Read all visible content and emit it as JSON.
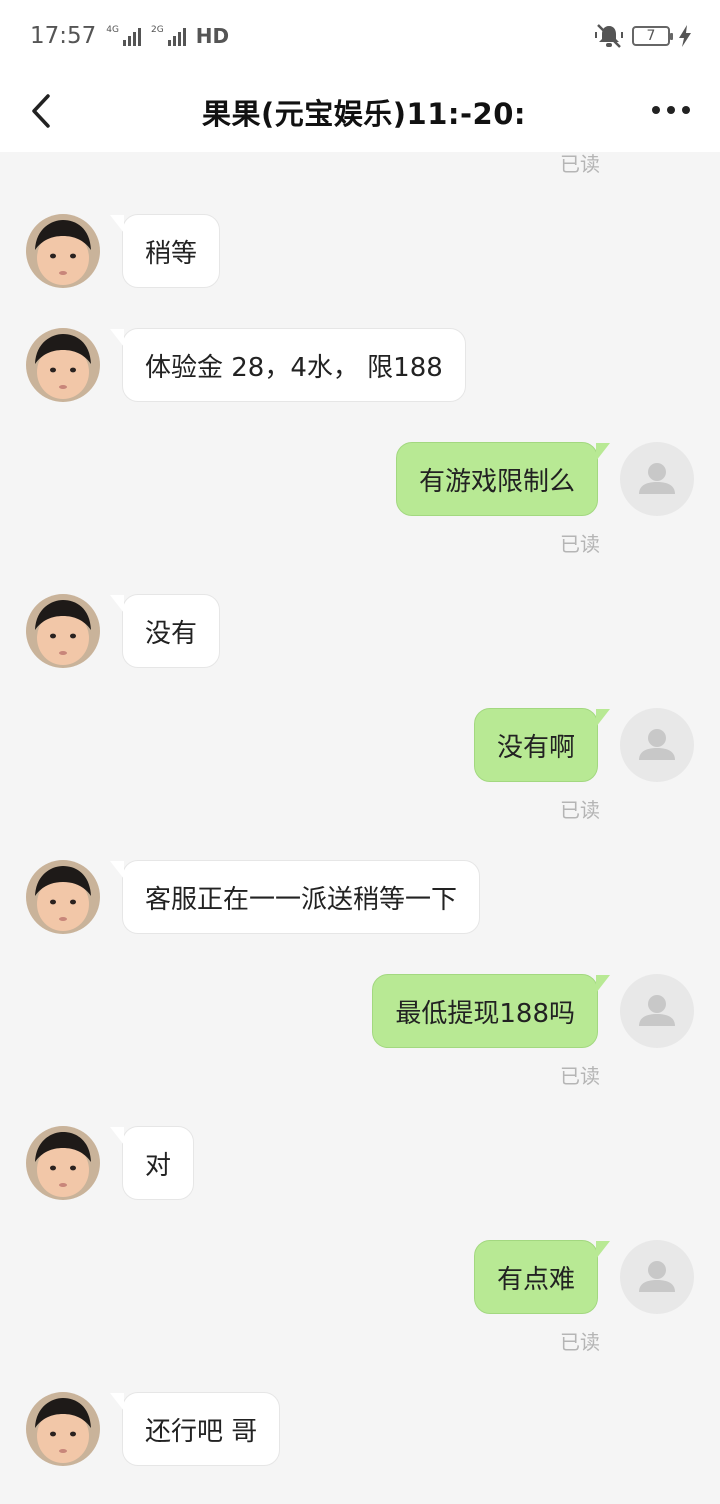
{
  "status_bar": {
    "time": "17:57",
    "signal1_tag": "4G",
    "signal2_tag": "2G",
    "hd": "HD",
    "battery": "7"
  },
  "header": {
    "title": "果果(元宝娱乐)11:-20:"
  },
  "read_label": "已读",
  "messages": [
    {
      "side": "in",
      "text": "稍等"
    },
    {
      "side": "in",
      "text": "体验金 28，4水， 限188"
    },
    {
      "side": "out",
      "text": "有游戏限制么"
    },
    {
      "side": "in",
      "text": "没有"
    },
    {
      "side": "out",
      "text": "没有啊"
    },
    {
      "side": "in",
      "text": "客服正在一一派送稍等一下"
    },
    {
      "side": "out",
      "text": "最低提现188吗"
    },
    {
      "side": "in",
      "text": "对"
    },
    {
      "side": "out",
      "text": "有点难"
    },
    {
      "side": "in",
      "text": "还行吧 哥"
    }
  ],
  "colors": {
    "outgoing_bubble": "#b8e994",
    "incoming_bubble": "#ffffff",
    "background": "#f5f5f5"
  }
}
